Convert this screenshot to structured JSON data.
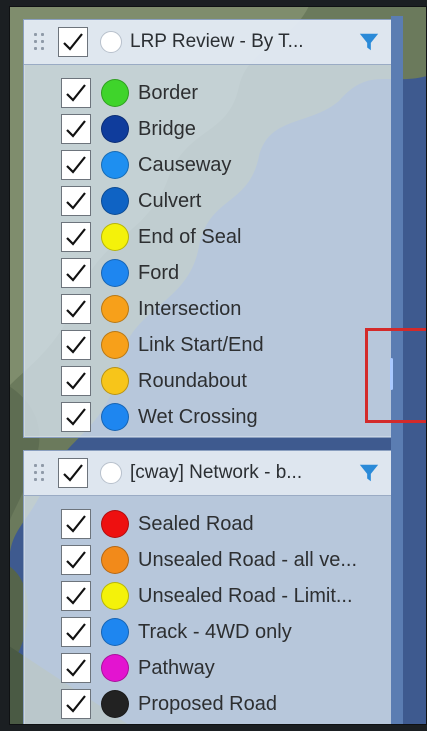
{
  "panels": [
    {
      "title": "LRP Review - By T...",
      "items": [
        {
          "label": "Border",
          "color": "#3fd42b"
        },
        {
          "label": "Bridge",
          "color": "#0f3c9c"
        },
        {
          "label": "Causeway",
          "color": "#1e8ff0"
        },
        {
          "label": "Culvert",
          "color": "#0f63c4"
        },
        {
          "label": "End of Seal",
          "color": "#f4f20a"
        },
        {
          "label": "Ford",
          "color": "#1e86f0"
        },
        {
          "label": "Intersection",
          "color": "#f7a01a"
        },
        {
          "label": "Link Start/End",
          "color": "#f7a01a"
        },
        {
          "label": "Roundabout",
          "color": "#f7c51a"
        },
        {
          "label": "Wet Crossing",
          "color": "#1e86f0"
        }
      ]
    },
    {
      "title": "[cway] Network - b...",
      "items": [
        {
          "label": "Sealed Road",
          "color": "#ee1010"
        },
        {
          "label": "Unsealed Road - all ve...",
          "color": "#f28a1a"
        },
        {
          "label": "Unsealed Road - Limit...",
          "color": "#f4f20a"
        },
        {
          "label": "Track - 4WD only",
          "color": "#1e86f0"
        },
        {
          "label": "Pathway",
          "color": "#e314d0"
        },
        {
          "label": "Proposed Road",
          "color": "#222222"
        }
      ]
    }
  ],
  "colors": {
    "filter_icon": "#2a8ad8",
    "highlight": "#d32a2a",
    "splitter": "#5b7db2"
  }
}
